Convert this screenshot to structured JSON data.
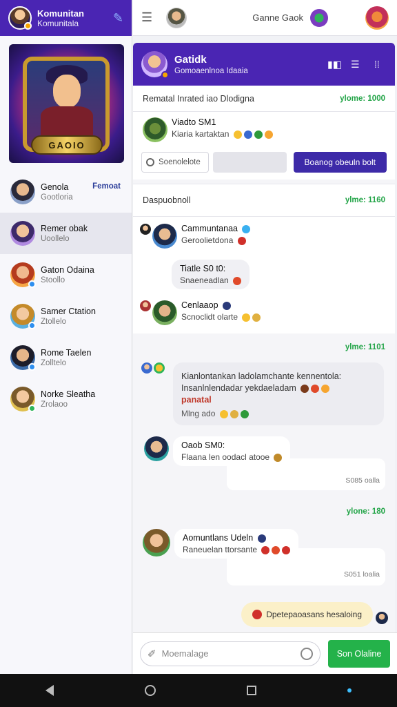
{
  "sidebar": {
    "header": {
      "title": "Komunitan",
      "subtitle": "Komunitala"
    },
    "banner_logo": "GAOIO",
    "items": [
      {
        "name": "Genola",
        "sub": "Gootloria",
        "tag": "Femoat"
      },
      {
        "name": "Remer obak",
        "sub": "Uoollelo",
        "tag": ""
      },
      {
        "name": "Gaton Odaina",
        "sub": "Stoollo",
        "tag": ""
      },
      {
        "name": "Samer Ctation",
        "sub": "Ztollelo",
        "tag": ""
      },
      {
        "name": "Rome Taelen",
        "sub": "Zolltelo",
        "tag": ""
      },
      {
        "name": "Norke Sleatha",
        "sub": "Zrolaoo",
        "tag": ""
      }
    ]
  },
  "topbar": {
    "title": "Ganne Gaok"
  },
  "chat": {
    "header": {
      "title": "Gatidk",
      "subtitle": "Gomoaenlnoa Idaaia"
    },
    "section1": {
      "title": "Rematal Inrated iao Dlodigna",
      "time": "ylome: 1000"
    },
    "msg1": {
      "name": "Viadto SM1",
      "text": "Kiaria kartaktan"
    },
    "search": {
      "placeholder": "Soenolelote",
      "button": "Boanog obeuln bolt"
    },
    "section2": {
      "title": "Daspuobnoll",
      "time": "ylme: 1160"
    },
    "msg2": {
      "name": "Cammuntanaa",
      "text": "Geroolietdona"
    },
    "msg3": {
      "name": "Tiatle S0 t0:",
      "text": "Snaeneadlan"
    },
    "msg4": {
      "name": "Cenlaaop",
      "text": "Scnoclidt olarte"
    },
    "time3": "ylme: 1101",
    "bubble": {
      "line1": "Kianlontankan ladolamchante kennentola:",
      "line2": "Insanlnlendadar yekdaeladam",
      "highlight": "panatal",
      "line3": "Mlng ado"
    },
    "msg5": {
      "name": "Oaob SM0:",
      "text": "Flaana len oodacl atooe",
      "meta": "S085 oalla"
    },
    "time4": "ylone: 180",
    "msg6": {
      "name": "Aomuntlans Udeln",
      "text": "Raneuelan ttorsante",
      "meta": "S051 loalia"
    },
    "outgoing": {
      "text": "Dpetepaoasans hesaloing"
    }
  },
  "composer": {
    "placeholder": "Moemalage",
    "send": "Son Olaline"
  }
}
